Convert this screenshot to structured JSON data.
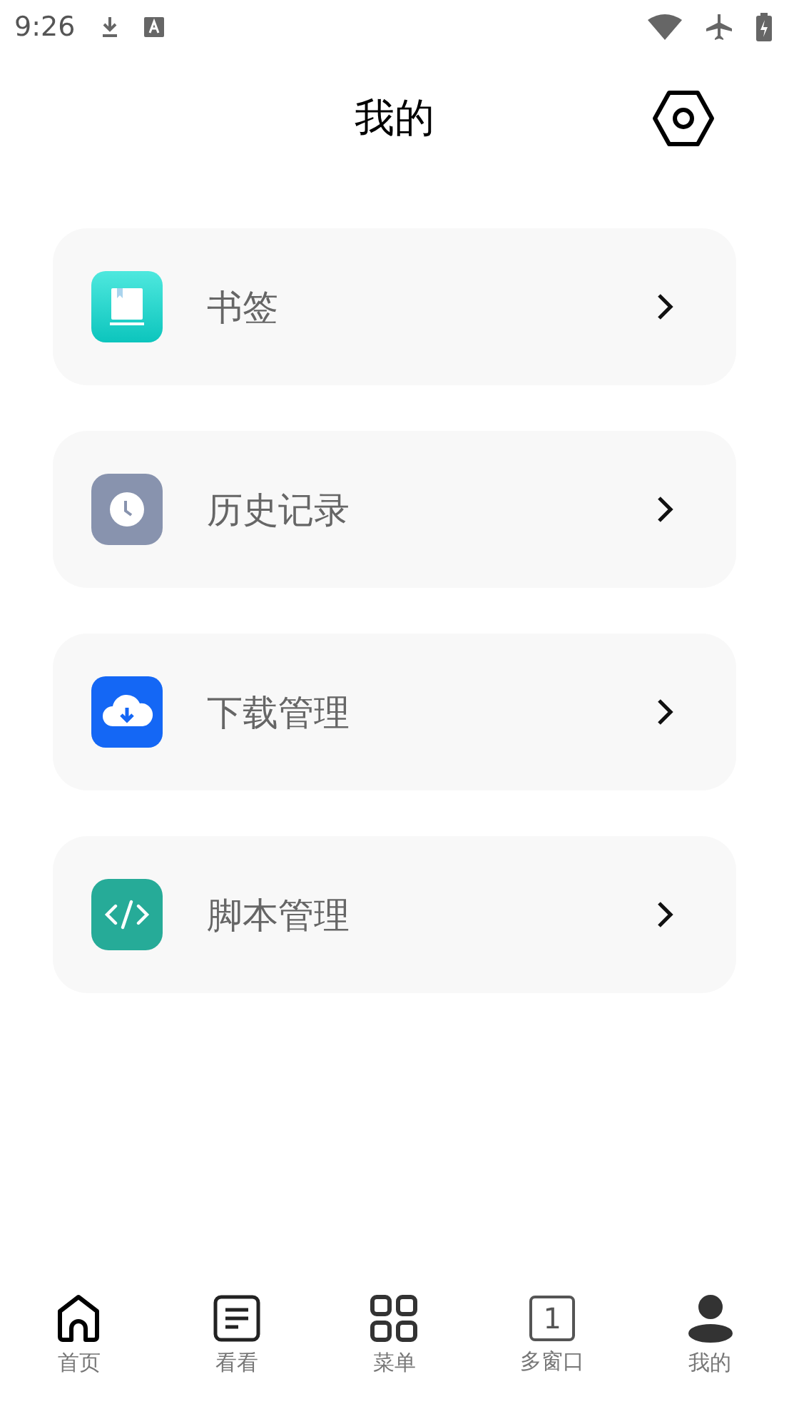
{
  "status_bar": {
    "time": "9:26"
  },
  "header": {
    "title": "我的"
  },
  "menu": [
    {
      "label": "书签",
      "kind": "bookmark"
    },
    {
      "label": "历史记录",
      "kind": "history"
    },
    {
      "label": "下载管理",
      "kind": "download"
    },
    {
      "label": "脚本管理",
      "kind": "script"
    }
  ],
  "tab_bar": [
    {
      "label": "首页",
      "kind": "home",
      "selected": false
    },
    {
      "label": "看看",
      "kind": "feed",
      "selected": false
    },
    {
      "label": "菜单",
      "kind": "grid",
      "selected": false
    },
    {
      "label": "多窗口",
      "kind": "windows",
      "count": "1",
      "selected": false
    },
    {
      "label": "我的",
      "kind": "profile",
      "selected": true
    }
  ]
}
